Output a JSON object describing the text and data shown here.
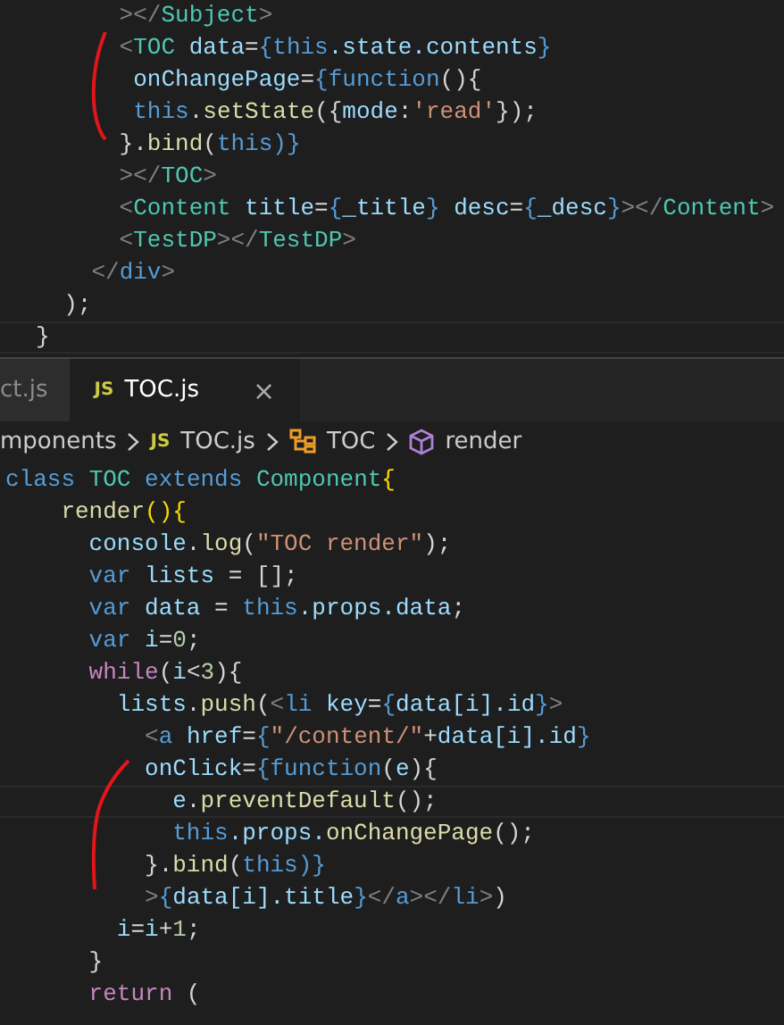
{
  "top_editor": {
    "lines": [
      {
        "current": false,
        "tokens": [
          {
            "text": "      ></",
            "kind": "punct"
          },
          {
            "text": "Subject",
            "kind": "tag"
          },
          {
            "text": ">",
            "kind": "punct"
          }
        ]
      },
      {
        "current": false,
        "tokens": [
          {
            "text": "      <",
            "kind": "punct"
          },
          {
            "text": "TOC",
            "kind": "tag"
          },
          {
            "text": " data",
            "kind": "attr"
          },
          {
            "text": "=",
            "kind": "plain"
          },
          {
            "text": "{",
            "kind": "keyword"
          },
          {
            "text": "this",
            "kind": "keyword"
          },
          {
            "text": ".state.contents",
            "kind": "attr"
          },
          {
            "text": "}",
            "kind": "keyword"
          }
        ]
      },
      {
        "current": false,
        "tokens": [
          {
            "text": "       onChangePage",
            "kind": "attr"
          },
          {
            "text": "=",
            "kind": "plain"
          },
          {
            "text": "{",
            "kind": "keyword"
          },
          {
            "text": "function",
            "kind": "keyword"
          },
          {
            "text": "(){",
            "kind": "plain"
          }
        ]
      },
      {
        "current": false,
        "tokens": [
          {
            "text": "       this",
            "kind": "keyword"
          },
          {
            "text": ".",
            "kind": "plain"
          },
          {
            "text": "setState",
            "kind": "func"
          },
          {
            "text": "({",
            "kind": "plain"
          },
          {
            "text": "mode",
            "kind": "attr"
          },
          {
            "text": ":",
            "kind": "plain"
          },
          {
            "text": "'read'",
            "kind": "string"
          },
          {
            "text": "});",
            "kind": "plain"
          }
        ]
      },
      {
        "current": false,
        "tokens": [
          {
            "text": "      }.",
            "kind": "plain"
          },
          {
            "text": "bind",
            "kind": "func"
          },
          {
            "text": "(",
            "kind": "plain"
          },
          {
            "text": "this",
            "kind": "keyword"
          },
          {
            "text": ")}",
            "kind": "keyword"
          }
        ]
      },
      {
        "current": false,
        "tokens": [
          {
            "text": "      ></",
            "kind": "punct"
          },
          {
            "text": "TOC",
            "kind": "tag"
          },
          {
            "text": ">",
            "kind": "punct"
          }
        ]
      },
      {
        "current": false,
        "tokens": [
          {
            "text": "      <",
            "kind": "punct"
          },
          {
            "text": "Content",
            "kind": "tag"
          },
          {
            "text": " title",
            "kind": "attr"
          },
          {
            "text": "=",
            "kind": "plain"
          },
          {
            "text": "{",
            "kind": "keyword"
          },
          {
            "text": "_title",
            "kind": "attr"
          },
          {
            "text": "}",
            "kind": "keyword"
          },
          {
            "text": " desc",
            "kind": "attr"
          },
          {
            "text": "=",
            "kind": "plain"
          },
          {
            "text": "{",
            "kind": "keyword"
          },
          {
            "text": "_desc",
            "kind": "attr"
          },
          {
            "text": "}",
            "kind": "keyword"
          },
          {
            "text": "></",
            "kind": "punct"
          },
          {
            "text": "Content",
            "kind": "tag"
          },
          {
            "text": ">",
            "kind": "punct"
          }
        ]
      },
      {
        "current": false,
        "tokens": [
          {
            "text": "      <",
            "kind": "punct"
          },
          {
            "text": "TestDP",
            "kind": "tag"
          },
          {
            "text": "></",
            "kind": "punct"
          },
          {
            "text": "TestDP",
            "kind": "tag"
          },
          {
            "text": ">",
            "kind": "punct"
          }
        ]
      },
      {
        "current": false,
        "tokens": [
          {
            "text": "    </",
            "kind": "punct"
          },
          {
            "text": "div",
            "kind": "keyword"
          },
          {
            "text": ">",
            "kind": "punct"
          }
        ]
      },
      {
        "current": false,
        "tokens": [
          {
            "text": "  );",
            "kind": "plain"
          }
        ]
      },
      {
        "current": true,
        "tokens": [
          {
            "text": "}",
            "kind": "plain"
          }
        ]
      }
    ]
  },
  "tabs": [
    {
      "label": "ct.js",
      "selected": false
    },
    {
      "label": "TOC.js",
      "icon": "JS",
      "selected": true,
      "close": "×"
    }
  ],
  "breadcrumb": [
    {
      "kind": "folder",
      "label": "mponents"
    },
    {
      "kind": "file",
      "badge": "JS",
      "label": "TOC.js"
    },
    {
      "kind": "class",
      "label": "TOC"
    },
    {
      "kind": "method",
      "label": "render"
    }
  ],
  "bottom_editor": {
    "lines": [
      {
        "current": false,
        "tokens": [
          {
            "text": "class",
            "kind": "keyword"
          },
          {
            "text": " TOC",
            "kind": "tag"
          },
          {
            "text": " extends",
            "kind": "keyword"
          },
          {
            "text": " Component",
            "kind": "tag"
          },
          {
            "text": "{",
            "kind": "gold"
          }
        ]
      },
      {
        "current": false,
        "tokens": [
          {
            "text": "    render",
            "kind": "func"
          },
          {
            "text": "(){",
            "kind": "gold"
          }
        ]
      },
      {
        "current": false,
        "tokens": [
          {
            "text": "      console",
            "kind": "attr"
          },
          {
            "text": ".",
            "kind": "plain"
          },
          {
            "text": "log",
            "kind": "func"
          },
          {
            "text": "(",
            "kind": "plain"
          },
          {
            "text": "\"TOC render\"",
            "kind": "string"
          },
          {
            "text": ");",
            "kind": "plain"
          }
        ]
      },
      {
        "current": false,
        "tokens": [
          {
            "text": "      var",
            "kind": "keyword"
          },
          {
            "text": " lists",
            "kind": "attr"
          },
          {
            "text": " = [];",
            "kind": "plain"
          }
        ]
      },
      {
        "current": false,
        "tokens": [
          {
            "text": "      var",
            "kind": "keyword"
          },
          {
            "text": " data",
            "kind": "attr"
          },
          {
            "text": " = ",
            "kind": "plain"
          },
          {
            "text": "this",
            "kind": "keyword"
          },
          {
            "text": ".props.data",
            "kind": "attr"
          },
          {
            "text": ";",
            "kind": "plain"
          }
        ]
      },
      {
        "current": false,
        "tokens": [
          {
            "text": "      var",
            "kind": "keyword"
          },
          {
            "text": " i",
            "kind": "attr"
          },
          {
            "text": "=",
            "kind": "plain"
          },
          {
            "text": "0",
            "kind": "number"
          },
          {
            "text": ";",
            "kind": "plain"
          }
        ]
      },
      {
        "current": false,
        "tokens": [
          {
            "text": "      while",
            "kind": "control"
          },
          {
            "text": "(",
            "kind": "plain"
          },
          {
            "text": "i",
            "kind": "attr"
          },
          {
            "text": "<",
            "kind": "plain"
          },
          {
            "text": "3",
            "kind": "number"
          },
          {
            "text": "){",
            "kind": "plain"
          }
        ]
      },
      {
        "current": false,
        "tokens": [
          {
            "text": "        lists",
            "kind": "attr"
          },
          {
            "text": ".",
            "kind": "plain"
          },
          {
            "text": "push",
            "kind": "func"
          },
          {
            "text": "(",
            "kind": "plain"
          },
          {
            "text": "<",
            "kind": "punct"
          },
          {
            "text": "li",
            "kind": "keyword"
          },
          {
            "text": " key",
            "kind": "attr"
          },
          {
            "text": "=",
            "kind": "plain"
          },
          {
            "text": "{",
            "kind": "keyword"
          },
          {
            "text": "data[i].id",
            "kind": "attr"
          },
          {
            "text": "}",
            "kind": "keyword"
          },
          {
            "text": ">",
            "kind": "punct"
          }
        ]
      },
      {
        "current": false,
        "tokens": [
          {
            "text": "          <",
            "kind": "punct"
          },
          {
            "text": "a",
            "kind": "keyword"
          },
          {
            "text": " href",
            "kind": "attr"
          },
          {
            "text": "=",
            "kind": "plain"
          },
          {
            "text": "{",
            "kind": "keyword"
          },
          {
            "text": "\"/content/\"",
            "kind": "string"
          },
          {
            "text": "+",
            "kind": "plain"
          },
          {
            "text": "data[i].id",
            "kind": "attr"
          },
          {
            "text": "}",
            "kind": "keyword"
          }
        ]
      },
      {
        "current": false,
        "tokens": [
          {
            "text": "          onClick",
            "kind": "attr"
          },
          {
            "text": "=",
            "kind": "plain"
          },
          {
            "text": "{",
            "kind": "keyword"
          },
          {
            "text": "function",
            "kind": "keyword"
          },
          {
            "text": "(",
            "kind": "plain"
          },
          {
            "text": "e",
            "kind": "attr"
          },
          {
            "text": "){",
            "kind": "plain"
          }
        ]
      },
      {
        "current": true,
        "tokens": [
          {
            "text": "            e",
            "kind": "attr"
          },
          {
            "text": ".",
            "kind": "plain"
          },
          {
            "text": "preventDefault",
            "kind": "func"
          },
          {
            "text": "();",
            "kind": "plain"
          }
        ]
      },
      {
        "current": false,
        "tokens": [
          {
            "text": "            this",
            "kind": "keyword"
          },
          {
            "text": ".props.",
            "kind": "attr"
          },
          {
            "text": "onChangePage",
            "kind": "func"
          },
          {
            "text": "();",
            "kind": "plain"
          }
        ]
      },
      {
        "current": false,
        "tokens": [
          {
            "text": "          }.",
            "kind": "plain"
          },
          {
            "text": "bind",
            "kind": "func"
          },
          {
            "text": "(",
            "kind": "plain"
          },
          {
            "text": "this",
            "kind": "keyword"
          },
          {
            "text": ")}",
            "kind": "keyword"
          }
        ]
      },
      {
        "current": false,
        "tokens": [
          {
            "text": "          >",
            "kind": "punct"
          },
          {
            "text": "{",
            "kind": "keyword"
          },
          {
            "text": "data[i].title",
            "kind": "attr"
          },
          {
            "text": "}",
            "kind": "keyword"
          },
          {
            "text": "</",
            "kind": "punct"
          },
          {
            "text": "a",
            "kind": "keyword"
          },
          {
            "text": "></",
            "kind": "punct"
          },
          {
            "text": "li",
            "kind": "keyword"
          },
          {
            "text": ">",
            "kind": "punct"
          },
          {
            "text": ")",
            "kind": "plain"
          }
        ]
      },
      {
        "current": false,
        "tokens": [
          {
            "text": "        i",
            "kind": "attr"
          },
          {
            "text": "=",
            "kind": "plain"
          },
          {
            "text": "i",
            "kind": "attr"
          },
          {
            "text": "+",
            "kind": "plain"
          },
          {
            "text": "1",
            "kind": "number"
          },
          {
            "text": ";",
            "kind": "plain"
          }
        ]
      },
      {
        "current": false,
        "tokens": [
          {
            "text": "      }",
            "kind": "plain"
          }
        ]
      },
      {
        "current": false,
        "tokens": [
          {
            "text": "      return",
            "kind": "control"
          },
          {
            "text": " (",
            "kind": "plain"
          }
        ]
      }
    ]
  }
}
